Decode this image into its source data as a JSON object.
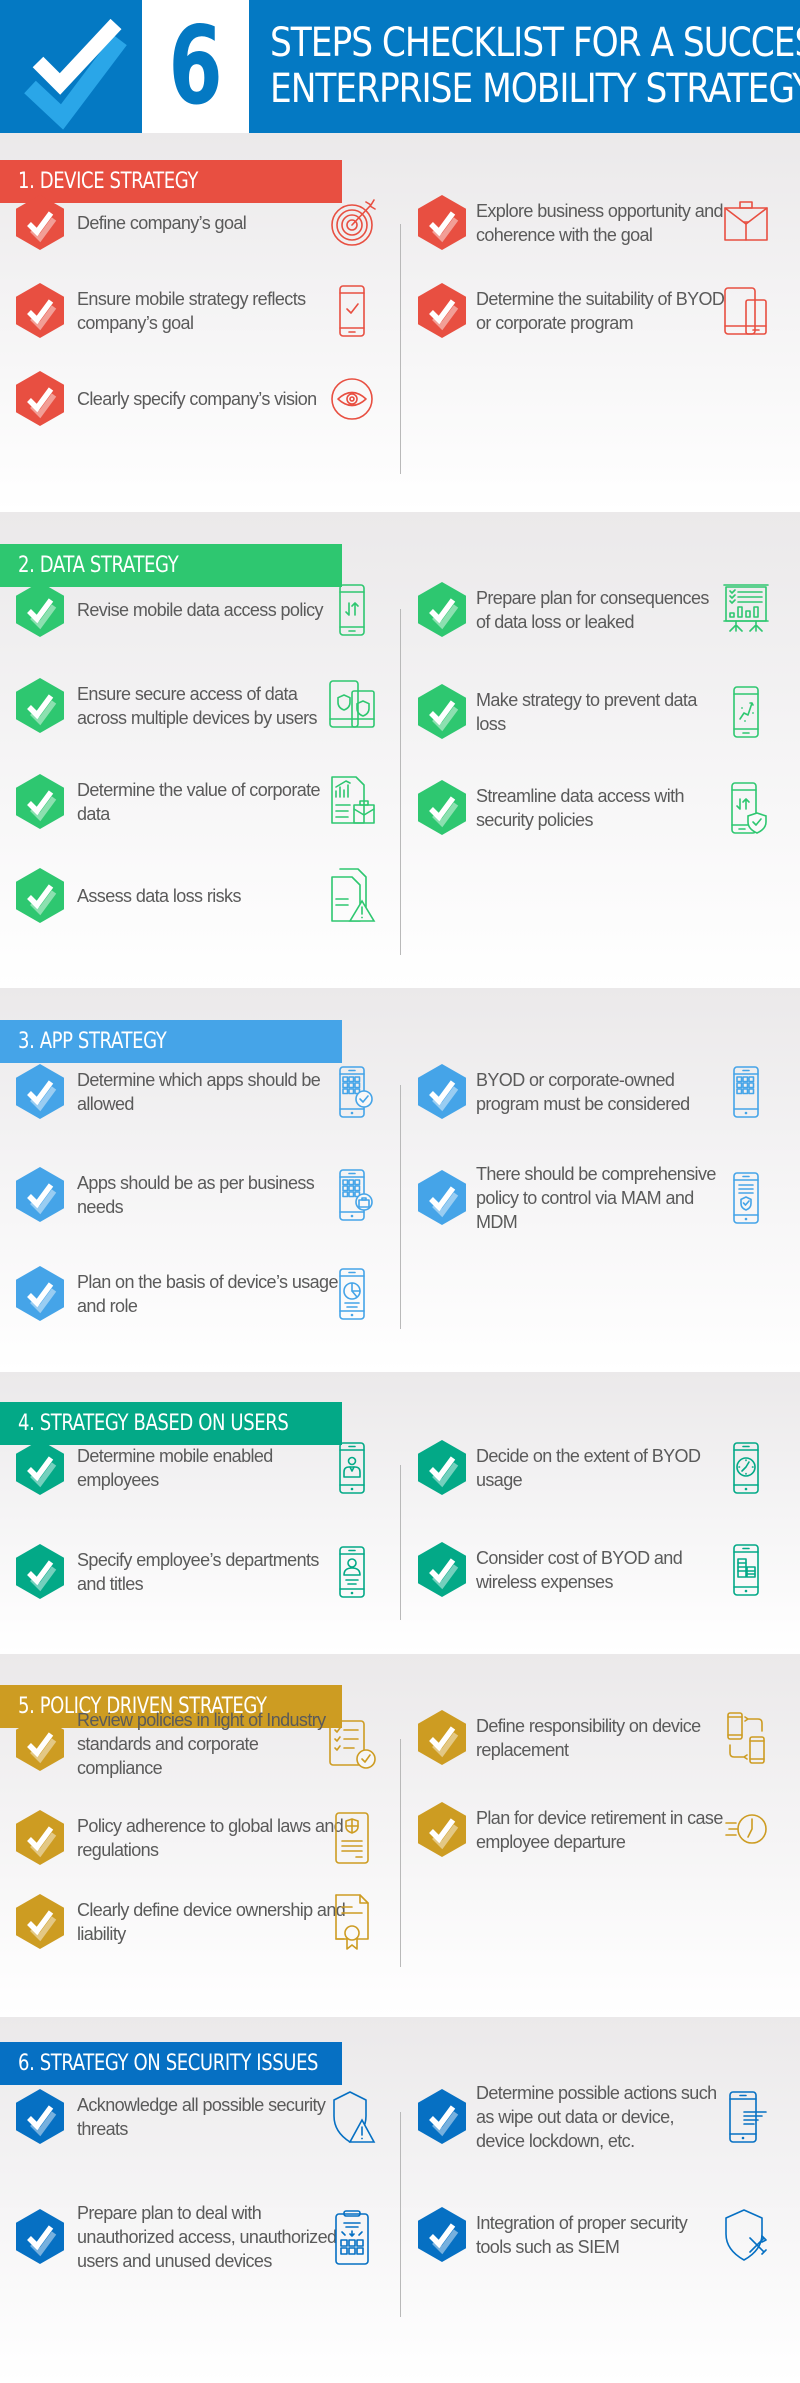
{
  "header": {
    "number": "6",
    "title_line1": "STEPS CHECKLIST FOR A SUCCESSFUL",
    "title_line2": "ENTERPRISE MOBILITY STRATEGY",
    "colors": {
      "background": "#0479c3",
      "check": "#ffffff",
      "check_shadow": "#2aa6e8"
    }
  },
  "sections": [
    {
      "title": "1. DEVICE STRATEGY",
      "color": "#e84f41",
      "left_items": [
        {
          "text": "Define company’s goal",
          "icon": "target-icon"
        },
        {
          "text": "Ensure mobile strategy reflects company’s goal",
          "icon": "phone-check-icon"
        },
        {
          "text": "Clearly specify company’s vision",
          "icon": "eye-icon"
        }
      ],
      "right_items": [
        {
          "text": "Explore business opportunity and coherence with the goal",
          "icon": "briefcase-icon"
        },
        {
          "text": "Determine the suitability of BYOD or corporate program",
          "icon": "tablet-phone-icon"
        }
      ]
    },
    {
      "title": "2. DATA STRATEGY",
      "color": "#2ec770",
      "left_items": [
        {
          "text": "Revise mobile data access policy",
          "icon": "phone-transfer-icon"
        },
        {
          "text": "Ensure secure access of data across multiple devices by users",
          "icon": "devices-shield-icon"
        },
        {
          "text": "Determine the value of corporate data",
          "icon": "report-briefcase-icon"
        },
        {
          "text": "Assess data loss risks",
          "icon": "document-warning-icon"
        }
      ],
      "right_items": [
        {
          "text": "Prepare plan for consequences of data loss or leaked",
          "icon": "presentation-board-icon"
        },
        {
          "text": "Make strategy to prevent data loss",
          "icon": "phone-strategy-icon"
        },
        {
          "text": "Streamline data access with security policies",
          "icon": "phone-shield-transfer-icon"
        }
      ]
    },
    {
      "title": "3. APP STRATEGY",
      "color": "#45a4e8",
      "left_items": [
        {
          "text": "Determine which apps should be allowed",
          "icon": "phone-apps-check-icon"
        },
        {
          "text": "Apps should be as per business needs",
          "icon": "phone-apps-briefcase-icon"
        },
        {
          "text": "Plan on the basis of device’s usage and role",
          "icon": "phone-pie-chart-icon"
        }
      ],
      "right_items": [
        {
          "text": "BYOD or corporate-owned program must be considered",
          "icon": "phone-apps-icon"
        },
        {
          "text": "There should be comprehensive policy to control via MAM and MDM",
          "icon": "phone-policy-shield-icon"
        }
      ]
    },
    {
      "title": "4. STRATEGY BASED ON USERS",
      "color": "#03a987",
      "left_items": [
        {
          "text": "Determine mobile enabled employees",
          "icon": "phone-user-icon"
        },
        {
          "text": "Specify employee’s departments and titles",
          "icon": "phone-profile-icon"
        }
      ],
      "right_items": [
        {
          "text": "Decide on the extent of BYOD usage",
          "icon": "phone-clock-icon"
        },
        {
          "text": "Consider cost of BYOD and wireless expenses",
          "icon": "phone-coins-icon"
        }
      ]
    },
    {
      "title": "5. POLICY DRIVEN STRATEGY",
      "color": "#cd9c22",
      "left_items": [
        {
          "text": "Review policies in light of Industry standards and corporate compliance",
          "icon": "checklist-icon"
        },
        {
          "text": "Policy adherence to global laws and regulations",
          "icon": "policy-document-icon"
        },
        {
          "text": "Clearly define device ownership and liability",
          "icon": "certificate-icon"
        }
      ],
      "right_items": [
        {
          "text": "Define responsibility on device replacement",
          "icon": "device-swap-icon"
        },
        {
          "text": "Plan for device retirement in case employee departure",
          "icon": "fast-clock-icon"
        }
      ]
    },
    {
      "title": "6. STRATEGY ON SECURITY ISSUES",
      "color": "#0670c3",
      "left_items": [
        {
          "text": "Acknowledge all possible security threats",
          "icon": "shield-warning-icon"
        },
        {
          "text": "Prepare plan to deal with unauthorized access, unauthorized users and unused devices",
          "icon": "clipboard-grid-icon"
        }
      ],
      "right_items": [
        {
          "text": "Determine possible actions such as wipe out data or device, device lockdown, etc.",
          "icon": "phone-wipe-icon"
        },
        {
          "text": "Integration of proper security tools such as SIEM",
          "icon": "shield-tools-icon"
        }
      ]
    }
  ]
}
